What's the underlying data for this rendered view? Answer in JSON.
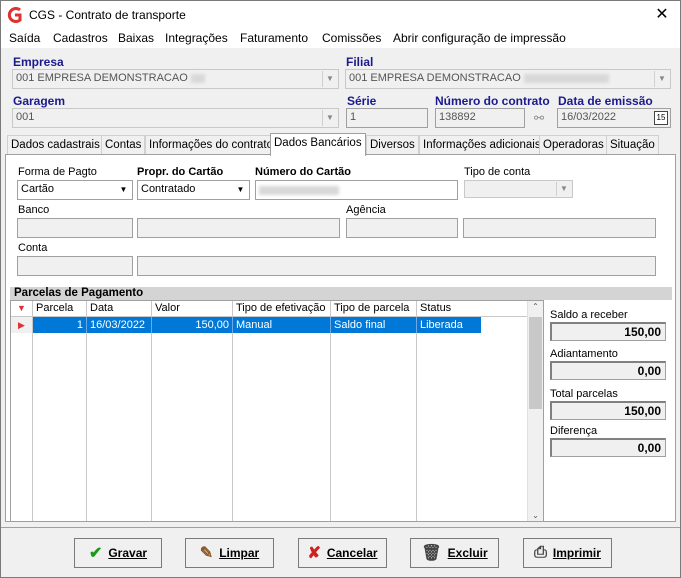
{
  "window": {
    "title": "CGS - Contrato de transporte",
    "close_glyph": "✕"
  },
  "menu": [
    "Saída",
    "Cadastros",
    "Baixas",
    "Integrações",
    "Faturamento",
    "Comissões",
    "Abrir configuração de impressão"
  ],
  "header": {
    "empresa_label": "Empresa",
    "empresa_value": "001 EMPRESA DEMONSTRACAO",
    "filial_label": "Filial",
    "filial_value": "001 EMPRESA DEMONSTRACAO",
    "garagem_label": "Garagem",
    "garagem_value": "001",
    "serie_label": "Série",
    "serie_value": "1",
    "numero_label": "Número do contrato",
    "numero_value": "138892",
    "data_label": "Data de emissão",
    "data_value": "16/03/2022",
    "calendar_glyph": "15"
  },
  "tabs": [
    "Dados cadastrais",
    "Contas",
    "Informações do contrato",
    "Dados Bancários",
    "Diversos",
    "Informações adicionais",
    "Operadoras",
    "Situação"
  ],
  "active_tab": "Dados Bancários",
  "bank": {
    "forma_label": "Forma de Pagto",
    "forma_value": "Cartão",
    "propr_label": "Propr. do Cartão",
    "propr_value": "Contratado",
    "numero_cartao_label": "Número do Cartão",
    "tipo_conta_label": "Tipo de conta",
    "banco_label": "Banco",
    "agencia_label": "Agência",
    "conta_label": "Conta"
  },
  "parcelas": {
    "title": "Parcelas de Pagamento",
    "columns": [
      "Parcela",
      "Data",
      "Valor",
      "Tipo de efetivação",
      "Tipo de parcela",
      "Status"
    ],
    "rows": [
      {
        "parcela": "1",
        "data": "16/03/2022",
        "valor": "150,00",
        "tipo_efetivacao": "Manual",
        "tipo_parcela": "Saldo final",
        "status": "Liberada"
      }
    ],
    "selection_color": "#0078d7"
  },
  "summary": {
    "saldo_label": "Saldo a receber",
    "saldo_value": "150,00",
    "adiantamento_label": "Adiantamento",
    "adiantamento_value": "0,00",
    "total_label": "Total parcelas",
    "total_value": "150,00",
    "diferenca_label": "Diferença",
    "diferenca_value": "0,00"
  },
  "buttons": {
    "gravar": "Gravar",
    "limpar": "Limpar",
    "cancelar": "Cancelar",
    "excluir": "Excluir",
    "imprimir": "Imprimir"
  },
  "colors": {
    "label_blue": "#1a1a8c",
    "brand_red": "#e03030"
  }
}
